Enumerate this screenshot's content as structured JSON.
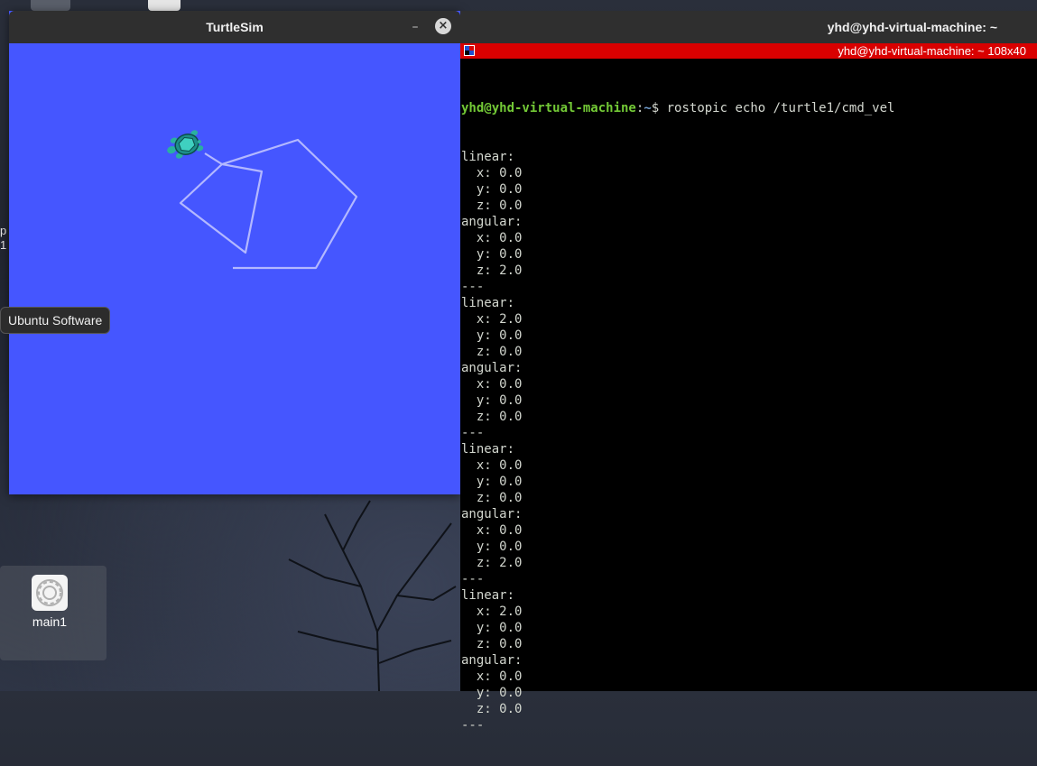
{
  "turtlesim": {
    "title": "TurtleSim",
    "minimize_glyph": "–",
    "close_glyph": "×",
    "background_color": "#4556ff",
    "pen_color": "#b3b8ff"
  },
  "terminal": {
    "window_title": "yhd@yhd-virtual-machine: ~",
    "status_text": "yhd@yhd-virtual-machine: ~ 108x40",
    "status_color": "#d90000",
    "prompt_user": "yhd@yhd-virtual-machine",
    "prompt_sep": ":",
    "prompt_path": "~",
    "prompt_symbol": "$ ",
    "command": "rostopic echo /turtle1/cmd_vel",
    "output_lines": [
      "linear:",
      "  x: 0.0",
      "  y: 0.0",
      "  z: 0.0",
      "angular:",
      "  x: 0.0",
      "  y: 0.0",
      "  z: 2.0",
      "---",
      "linear:",
      "  x: 2.0",
      "  y: 0.0",
      "  z: 0.0",
      "angular:",
      "  x: 0.0",
      "  y: 0.0",
      "  z: 0.0",
      "---",
      "linear:",
      "  x: 0.0",
      "  y: 0.0",
      "  z: 0.0",
      "angular:",
      "  x: 0.0",
      "  y: 0.0",
      "  z: 2.0",
      "---",
      "linear:",
      "  x: 2.0",
      "  y: 0.0",
      "  z: 0.0",
      "angular:",
      "  x: 0.0",
      "  y: 0.0",
      "  z: 0.0",
      "---"
    ]
  },
  "desktop": {
    "tooltip": "Ubuntu Software",
    "edge_chars": [
      "p",
      "1"
    ],
    "icon_label": "main1",
    "icon_name": "gear-icon"
  }
}
